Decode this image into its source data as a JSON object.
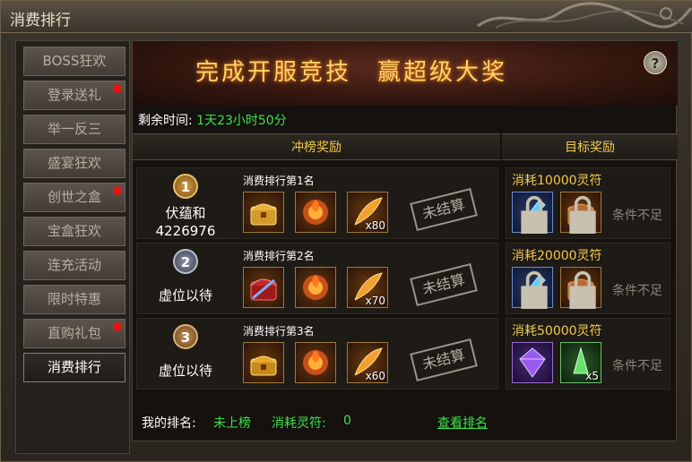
{
  "window": {
    "title": "消费排行"
  },
  "nav": {
    "items": [
      {
        "label": "BOSS狂欢",
        "dot": false,
        "active": false
      },
      {
        "label": "登录送礼",
        "dot": true,
        "active": false
      },
      {
        "label": "举一反三",
        "dot": false,
        "active": false
      },
      {
        "label": "盛宴狂欢",
        "dot": false,
        "active": false
      },
      {
        "label": "创世之盒",
        "dot": true,
        "active": false
      },
      {
        "label": "宝盒狂欢",
        "dot": false,
        "active": false
      },
      {
        "label": "连充活动",
        "dot": false,
        "active": false
      },
      {
        "label": "限时特惠",
        "dot": false,
        "active": false
      },
      {
        "label": "直购礼包",
        "dot": true,
        "active": false
      },
      {
        "label": "消费排行",
        "dot": false,
        "active": true
      }
    ]
  },
  "banner": {
    "text": "完成开服竞技　赢超级大奖",
    "help": "?"
  },
  "timer": {
    "label": "剩余时间:",
    "value": "1天23小时50分"
  },
  "columns": {
    "rank": "冲榜奖励",
    "goal": "目标奖励"
  },
  "ranks": [
    {
      "medal": "1",
      "tier": "gold",
      "name": "伏蕴和",
      "score": "4226976",
      "label": "消费排行第1名",
      "qty": "x80",
      "stamp": "未结算"
    },
    {
      "medal": "2",
      "tier": "silver",
      "name": "虚位以待",
      "score": "",
      "label": "消费排行第2名",
      "qty": "x70",
      "stamp": "未结算"
    },
    {
      "medal": "3",
      "tier": "bronze",
      "name": "虚位以待",
      "score": "",
      "label": "消费排行第3名",
      "qty": "x60",
      "stamp": "未结算"
    }
  ],
  "goals": [
    {
      "label": "消耗10000灵符",
      "status": "条件不足",
      "qty": ""
    },
    {
      "label": "消耗20000灵符",
      "status": "条件不足",
      "qty": ""
    },
    {
      "label": "消耗50000灵符",
      "status": "条件不足",
      "qty": "x5"
    }
  ],
  "footer": {
    "my_rank_label": "我的排名:",
    "my_rank_value": "未上榜",
    "spent_label": "消耗灵符:",
    "spent_value": "0",
    "view_link": "查看排名"
  },
  "colors": {
    "accent_gold": "#f2c94c",
    "accent_green": "#3ee14a",
    "notify_red": "#e01616"
  }
}
